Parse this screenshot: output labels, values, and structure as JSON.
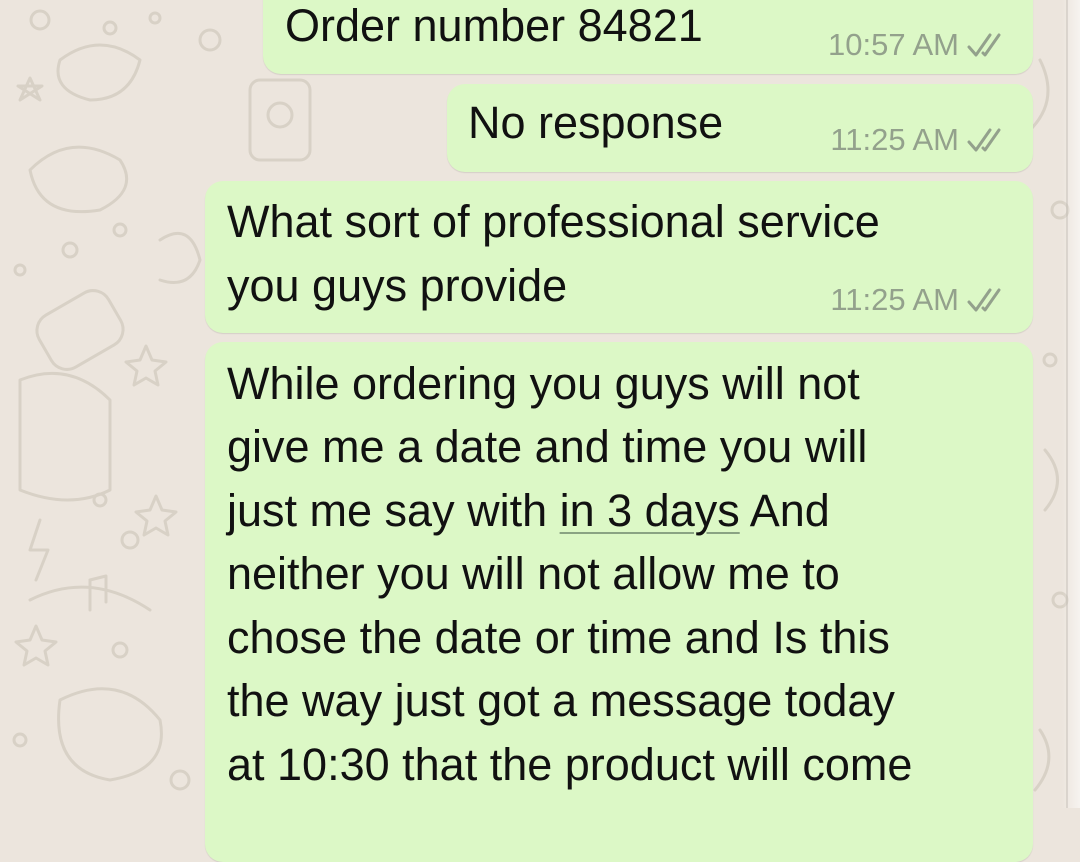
{
  "chat": {
    "messages": [
      {
        "text": "Order number 84821",
        "time": "10:57 AM",
        "status_icon": "double-check-icon"
      },
      {
        "text": "No response",
        "time": "11:25 AM",
        "status_icon": "double-check-icon"
      },
      {
        "lines": [
          "What sort of professional service",
          "you guys provide"
        ],
        "time": "11:25 AM",
        "status_icon": "double-check-icon"
      },
      {
        "lines": [
          "While ordering you guys will not",
          "give me a date and time you will",
          "just me say with ",
          "neither you will not allow me to",
          "chose the date or time and Is this",
          "the way just got a message today",
          "at 10:30 that the product will come"
        ],
        "link": "in 3 days",
        "line3_tail": " And"
      }
    ]
  },
  "colors": {
    "background": "#ece5dd",
    "outgoing_bubble": "#dcf8c6",
    "meta_text": "#93a18c"
  }
}
